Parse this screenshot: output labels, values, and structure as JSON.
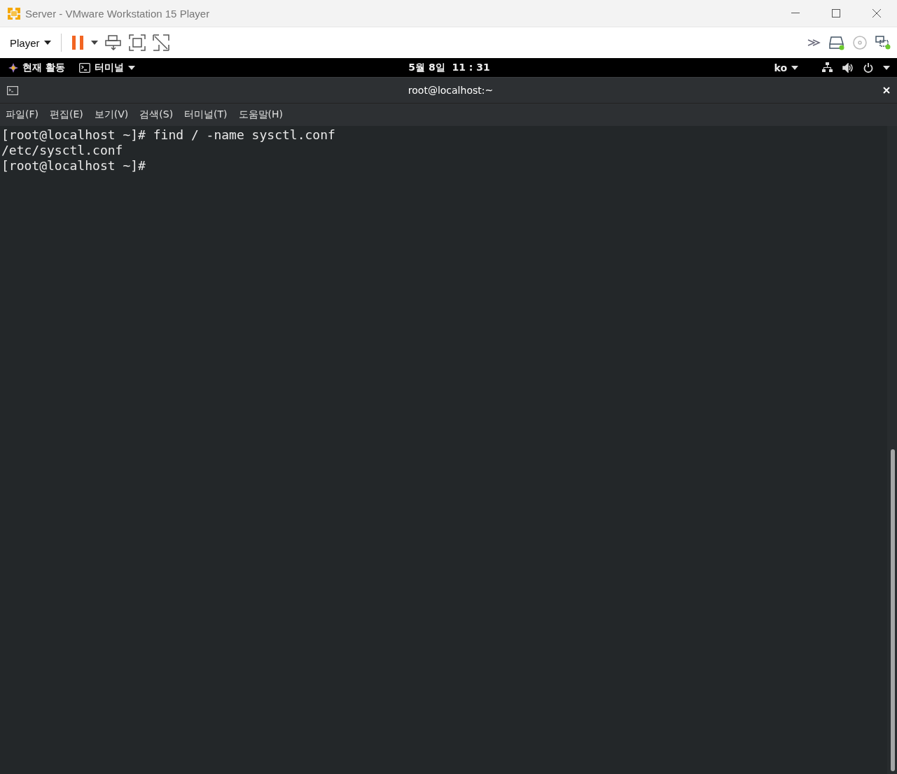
{
  "window": {
    "title": "Server - VMware Workstation 15 Player"
  },
  "toolbar": {
    "player_menu": "Player"
  },
  "top_bar": {
    "activities": "현재 활동",
    "app_menu": "터미널",
    "clock": "5월 8일  11 : 31",
    "language": "ko"
  },
  "terminal": {
    "title": "root@localhost:~",
    "menus": [
      "파일(F)",
      "편집(E)",
      "보기(V)",
      "검색(S)",
      "터미널(T)",
      "도움말(H)"
    ],
    "lines": [
      "[root@localhost ~]# find / -name sysctl.conf",
      "/etc/sysctl.conf",
      "[root@localhost ~]#"
    ]
  }
}
